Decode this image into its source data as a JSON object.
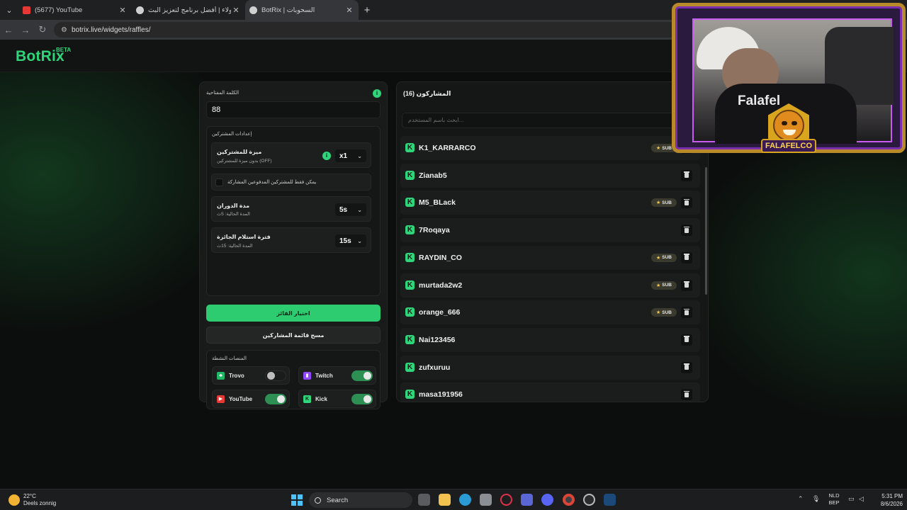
{
  "browser": {
    "tabs": [
      {
        "title": "(5677) YouTube",
        "color": "#e53935"
      },
      {
        "title": "الولاء | أفضل برنامج لتعزيز البث",
        "color": "#bdbdbd"
      },
      {
        "title": "BotRix | السحوبات",
        "color": "#bdbdbd"
      }
    ],
    "url": "botrix.live/widgets/raffles/"
  },
  "header": {
    "logo": "BotRix",
    "beta": "BETA"
  },
  "left_panel": {
    "keyword_label": "الكلمة المفتاحية",
    "keyword_value": "88",
    "subscribers_settings": {
      "title": "إعدادات المشتركين",
      "advantage": {
        "title": "ميزة للمشتركين",
        "subtitle": "بدون ميزة للمشتركين (OFF)",
        "select": "x1"
      },
      "paid_only": "يمكن فقط للمشتركين المدفوعين المشاركة"
    },
    "spin": {
      "title": "مدة الدوران",
      "subtitle": "المدة الحالية: 5ث",
      "select": "5s"
    },
    "claim": {
      "title": "فترة استلام الجائزة",
      "subtitle": "المدة الحالية: 15ث",
      "select": "15s"
    },
    "pick_winner": "اختيار الفائز",
    "clear_list": "مسح قائمة المشاركين",
    "platforms": {
      "title": "المنصات النشطة",
      "items": [
        {
          "name": "Trovo",
          "on": false,
          "color": "#1fb866"
        },
        {
          "name": "Twitch",
          "on": true,
          "color": "#9146ff"
        },
        {
          "name": "YouTube",
          "on": true,
          "color": "#e53935"
        },
        {
          "name": "Kick",
          "on": true,
          "color": "#53fc18"
        }
      ]
    }
  },
  "right_panel": {
    "title": "المشاركون (16)",
    "search_placeholder": "ابحث باسم المستخدم...",
    "participants": [
      {
        "name": "K1_KARRARCO",
        "sub": true
      },
      {
        "name": "Zianab5",
        "sub": false
      },
      {
        "name": "M5_BLack",
        "sub": true
      },
      {
        "name": "7Roqaya",
        "sub": false
      },
      {
        "name": "RAYDIN_CO",
        "sub": true
      },
      {
        "name": "murtada2w2",
        "sub": true
      },
      {
        "name": "orange_666",
        "sub": true
      },
      {
        "name": "Nai123456",
        "sub": false
      },
      {
        "name": "zufxuruu",
        "sub": false
      },
      {
        "name": "masa191956",
        "sub": false
      }
    ],
    "sub_badge": "SUB"
  },
  "overlay": {
    "shirt_text": "Falafel",
    "mascot": "FALAFELCO"
  },
  "taskbar": {
    "weather_temp": "22°C",
    "weather_text": "Deels zonnig",
    "search": "Search",
    "lang_1": "NLD",
    "lang_2": "BEP",
    "time": "5:31 PM",
    "date": "8/6/2026"
  }
}
